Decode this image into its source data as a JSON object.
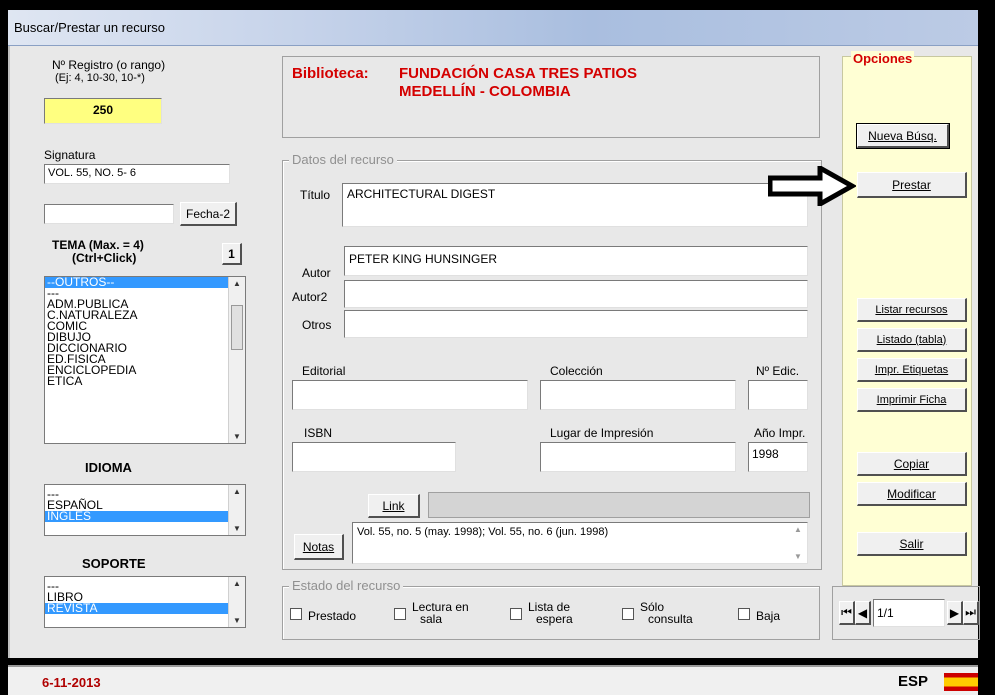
{
  "window": {
    "title": "Buscar/Prestar un recurso"
  },
  "left": {
    "registro_label": "Nº Registro  (o rango)",
    "registro_hint": "(Ej: 4, 10-30, 10-*)",
    "registro_value": "250",
    "signatura_label": "Signatura",
    "signatura_value": "VOL. 55, NO. 5- 6",
    "fecha2_value": "",
    "fecha2_button": "Fecha-2",
    "tema_label_1": "TEMA (Max. = 4)",
    "tema_label_2": "(Ctrl+Click)",
    "tema_count": "1",
    "temas": [
      "--OUTROS--",
      "---",
      "ADM.PUBLICA",
      "C.NATURALEZA",
      "COMIC",
      "DIBUJO",
      "DICCIONARIO",
      "ED.FISICA",
      "ENCICLOPEDIA",
      "ETICA"
    ],
    "idioma_label": "IDIOMA",
    "idiomas": [
      "---",
      "ESPAÑOL",
      "INGLES"
    ],
    "soporte_label": "SOPORTE",
    "soportes": [
      "---",
      "LIBRO",
      "REVISTA"
    ]
  },
  "library": {
    "prefix": "Biblioteca:",
    "name": "FUNDACIÓN CASA TRES PATIOS",
    "city": "MEDELLÍN - COLOMBIA"
  },
  "resource": {
    "group_label": "Datos del recurso",
    "titulo_label": "Título",
    "titulo_value": "ARCHITECTURAL DIGEST",
    "autor_label": "Autor",
    "autor_value": "PETER KING HUNSINGER",
    "autor2_label": "Autor2",
    "autor2_value": "",
    "otros_label": "Otros",
    "otros_value": "",
    "editorial_label": "Editorial",
    "editorial_value": "",
    "coleccion_label": "Colección",
    "coleccion_value": "",
    "edicion_label": "Nº Edic.",
    "edicion_value": "",
    "isbn_label": "ISBN",
    "isbn_value": "",
    "lugar_label": "Lugar de Impresión",
    "lugar_value": "",
    "anio_label": "Año Impr.",
    "anio_value": "1998",
    "link_button": "Link",
    "link_value": "",
    "notas_button": "Notas",
    "notas_value": "Vol. 55, no. 5 (may. 1998); Vol. 55, no. 6 (jun. 1998)"
  },
  "estado": {
    "group_label": "Estado del recurso",
    "options": [
      {
        "l1": "Prestado",
        "l2": ""
      },
      {
        "l1": "Lectura en",
        "l2": "sala"
      },
      {
        "l1": "Lista de",
        "l2": "espera"
      },
      {
        "l1": "Sólo",
        "l2": "consulta"
      },
      {
        "l1": "Baja",
        "l2": ""
      }
    ]
  },
  "options": {
    "group_label": "Opciones",
    "nueva": "Nueva Búsq.",
    "prestar": "Prestar",
    "listar": "Listar recursos",
    "listado": "Listado (tabla)",
    "etiquetas": "Impr. Etiquetas",
    "ficha": "Imprimir Ficha",
    "copiar": "Copiar",
    "modificar": "Modificar",
    "salir": "Salir"
  },
  "nav": {
    "position": "1/1"
  },
  "status": {
    "date": "6-11-2013",
    "lang": "ESP"
  },
  "colors": {
    "accent_red": "#d40000",
    "highlight_yellow": "#ffff80",
    "selection_blue": "#3399ff",
    "options_bg": "#ffffd4"
  }
}
